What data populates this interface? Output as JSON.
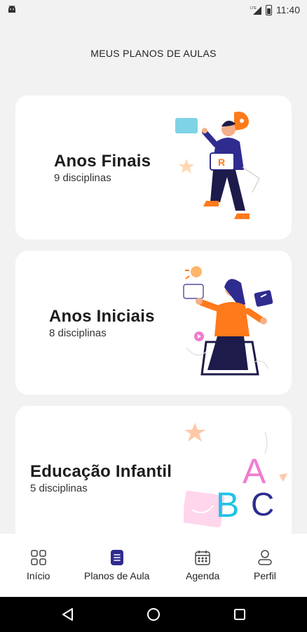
{
  "status_bar": {
    "time": "11:40",
    "network": "LTE",
    "icons": [
      "android-icon",
      "signal-icon",
      "battery-icon"
    ]
  },
  "header": {
    "title": "MEUS PLANOS DE AULAS"
  },
  "cards": [
    {
      "title": "Anos Finais",
      "subtitle": "9 disciplinas",
      "illustration": "student-with-laptop-illustration"
    },
    {
      "title": "Anos Iniciais",
      "subtitle": "8 disciplinas",
      "illustration": "girl-from-tablet-illustration"
    },
    {
      "title": "Educação Infantil",
      "subtitle": "5 disciplinas",
      "illustration": "abc-letters-illustration"
    }
  ],
  "bottom_nav": {
    "items": [
      {
        "label": "Início",
        "icon": "grid-icon",
        "active": false
      },
      {
        "label": "Planos de Aula",
        "icon": "document-icon",
        "active": true
      },
      {
        "label": "Agenda",
        "icon": "calendar-icon",
        "active": false
      },
      {
        "label": "Perfil",
        "icon": "person-icon",
        "active": false
      }
    ]
  },
  "colors": {
    "background": "#f2f2f3",
    "card": "#ffffff",
    "accent": "#2f2c8f",
    "orange": "#ff7a1a",
    "pink": "#f07ccf",
    "cyan": "#1fc3e6"
  }
}
